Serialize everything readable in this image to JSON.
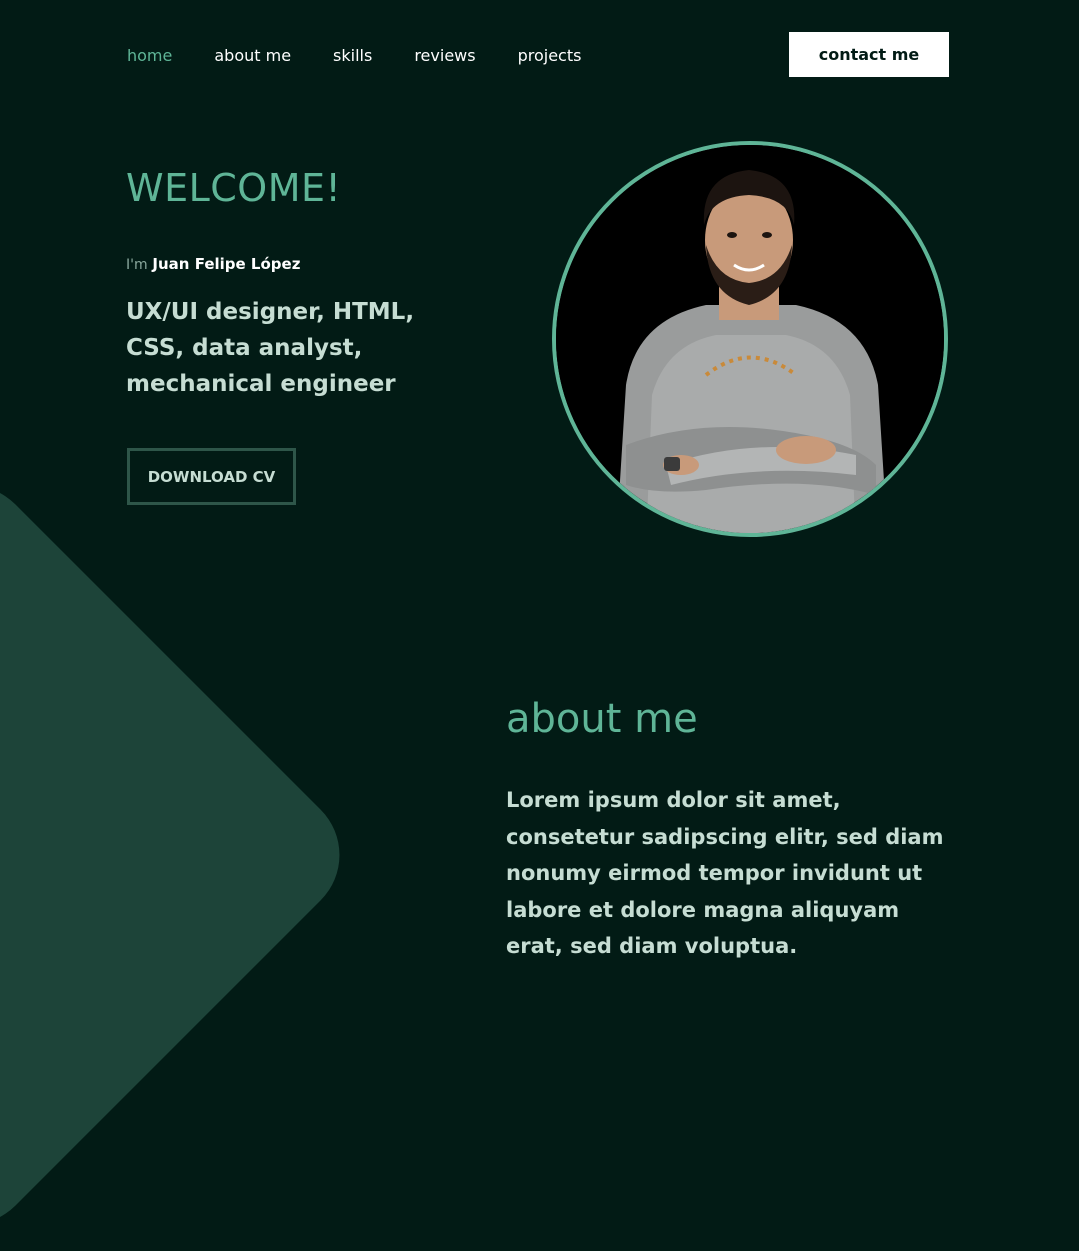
{
  "nav": {
    "items": [
      {
        "label": "home",
        "active": true
      },
      {
        "label": "about me",
        "active": false
      },
      {
        "label": "skills",
        "active": false
      },
      {
        "label": "reviews",
        "active": false
      },
      {
        "label": "projects",
        "active": false
      }
    ],
    "contact_label": "contact me"
  },
  "hero": {
    "welcome": "WELCOME!",
    "intro_prefix": "I'm",
    "name": "Juan Felipe López",
    "roles": "UX/UI designer, HTML, CSS, data analyst, mechanical engineer",
    "cv_label": "DOWNLOAD CV"
  },
  "about": {
    "title": "about me",
    "body": "Lorem ipsum dolor sit amet, consetetur sadipscing elitr, sed diam nonumy eirmod tempor invidunt ut labore et dolore magna aliquyam erat, sed diam voluptua."
  },
  "colors": {
    "background": "#021b15",
    "accent": "#5fb597",
    "shape": "#1d4439",
    "text_light": "#c6ddd3"
  },
  "icons": {
    "avatar": "profile-photo-icon"
  }
}
